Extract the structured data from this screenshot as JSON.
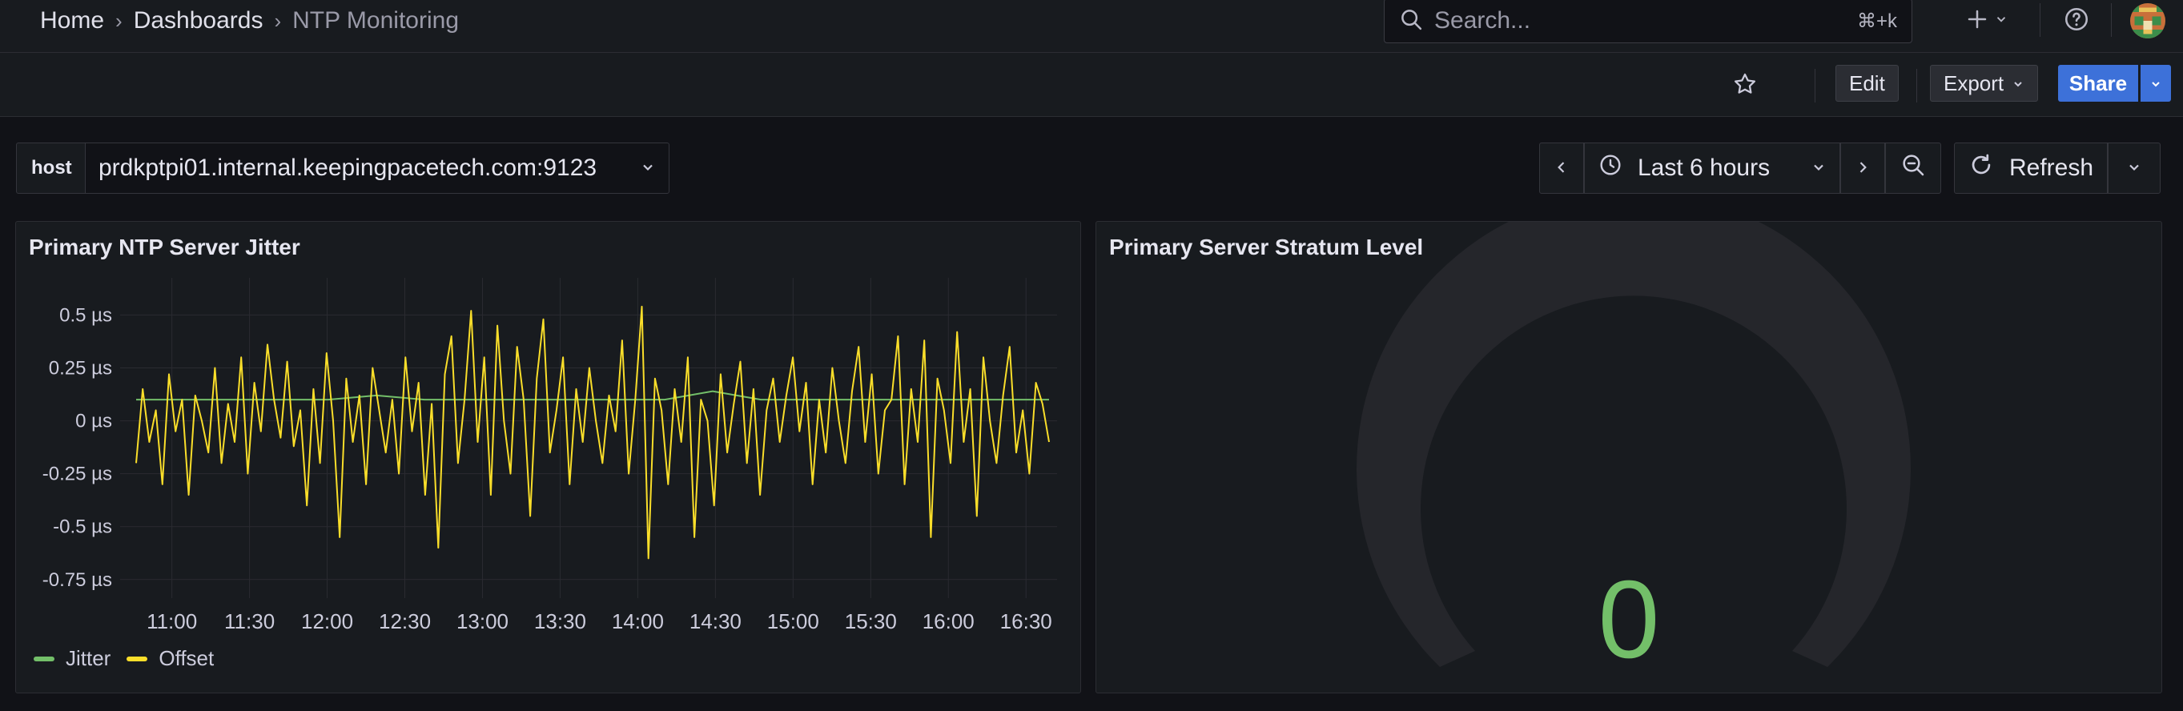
{
  "breadcrumb": {
    "home": "Home",
    "dashboards": "Dashboards",
    "current": "NTP Monitoring",
    "separator": "›"
  },
  "search": {
    "placeholder": "Search...",
    "shortcut": "⌘+k"
  },
  "topbar_icons": {
    "add": "plus-icon",
    "help": "help-icon",
    "avatar": "user-avatar"
  },
  "toolbar": {
    "edit_label": "Edit",
    "export_label": "Export",
    "share_label": "Share",
    "star": "star-icon"
  },
  "variable": {
    "label": "host",
    "value": "prdkptpi01.internal.keepingpacetech.com:9123"
  },
  "time_picker": {
    "range_label": "Last 6 hours",
    "refresh_label": "Refresh"
  },
  "colors": {
    "accent": "#3d71d9",
    "jitter": "#73bf69",
    "offset": "#fade2a",
    "gauge_value": "#73bf69",
    "gauge_track": "#25262b"
  },
  "panels": {
    "jitter": {
      "title": "Primary NTP Server Jitter",
      "legend": [
        {
          "label": "Jitter",
          "color": "#73bf69"
        },
        {
          "label": "Offset",
          "color": "#fade2a"
        }
      ]
    },
    "stratum": {
      "title": "Primary Server Stratum Level",
      "value": "0"
    }
  },
  "chart_data": {
    "type": "line",
    "title": "Primary NTP Server Jitter",
    "xlabel": "",
    "ylabel": "",
    "x_ticks": [
      "11:00",
      "11:30",
      "12:00",
      "12:30",
      "13:00",
      "13:30",
      "14:00",
      "14:30",
      "15:00",
      "15:30",
      "16:00",
      "16:30"
    ],
    "y_ticks": [
      "0.5 µs",
      "0.25 µs",
      "0 µs",
      "-0.25 µs",
      "-0.5 µs",
      "-0.75 µs"
    ],
    "y_unit": "µs",
    "ylim": [
      -0.8,
      0.6
    ],
    "x_range": [
      "10:40",
      "16:42"
    ],
    "grid": true,
    "legend_position": "bottom-left",
    "series": [
      {
        "name": "Jitter",
        "color": "#73bf69",
        "values": [
          0.1,
          0.1,
          0.1,
          0.1,
          0.1,
          0.12,
          0.1,
          0.1,
          0.1,
          0.1,
          0.1,
          0.1,
          0.14,
          0.1,
          0.1,
          0.1,
          0.1,
          0.1,
          0.1,
          0.1
        ]
      },
      {
        "name": "Offset",
        "color": "#fade2a",
        "values": [
          -0.2,
          0.15,
          -0.1,
          0.05,
          -0.3,
          0.22,
          -0.05,
          0.1,
          -0.35,
          0.12,
          0.0,
          -0.15,
          0.25,
          -0.2,
          0.08,
          -0.1,
          0.3,
          -0.25,
          0.18,
          -0.05,
          0.36,
          0.1,
          -0.08,
          0.28,
          -0.12,
          0.05,
          -0.4,
          0.15,
          -0.2,
          0.32,
          0.0,
          -0.55,
          0.2,
          -0.1,
          0.12,
          -0.3,
          0.25,
          0.05,
          -0.15,
          0.1,
          -0.25,
          0.3,
          -0.05,
          0.18,
          -0.35,
          0.08,
          -0.6,
          0.22,
          0.4,
          -0.2,
          0.1,
          0.52,
          -0.1,
          0.3,
          -0.35,
          0.45,
          0.0,
          -0.25,
          0.35,
          0.1,
          -0.45,
          0.2,
          0.48,
          -0.15,
          0.05,
          0.3,
          -0.3,
          0.15,
          -0.1,
          0.25,
          0.0,
          -0.2,
          0.12,
          -0.05,
          0.38,
          -0.25,
          0.1,
          0.54,
          -0.65,
          0.2,
          0.05,
          -0.3,
          0.15,
          -0.1,
          0.3,
          -0.55,
          0.1,
          0.0,
          -0.4,
          0.22,
          -0.15,
          0.08,
          0.28,
          -0.2,
          0.15,
          -0.35,
          0.05,
          0.2,
          -0.1,
          0.12,
          0.3,
          -0.05,
          0.18,
          -0.3,
          0.1,
          -0.15,
          0.25,
          0.0,
          -0.2,
          0.14,
          0.35,
          -0.1,
          0.22,
          -0.25,
          0.05,
          0.1,
          0.4,
          -0.3,
          0.15,
          -0.1,
          0.38,
          -0.55,
          0.2,
          0.05,
          -0.2,
          0.42,
          -0.1,
          0.15,
          -0.45,
          0.3,
          0.0,
          -0.2,
          0.12,
          0.35,
          -0.15,
          0.05,
          -0.25,
          0.18,
          0.08,
          -0.1
        ]
      }
    ]
  }
}
